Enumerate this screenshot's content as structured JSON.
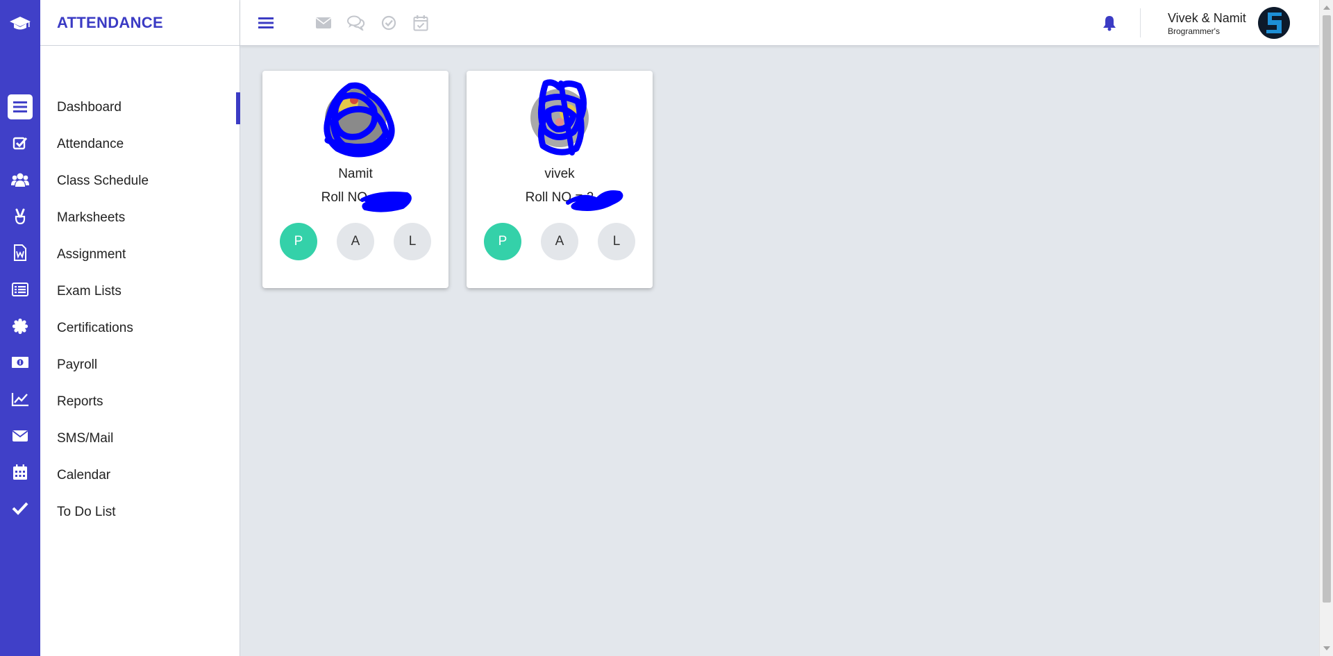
{
  "app": {
    "brand_title": "ATTENDANCE",
    "accent_color": "#3b3bc4",
    "present_color": "#34d1a9"
  },
  "rail": {
    "logo_icon": "graduation-cap-icon",
    "icons": [
      "list-icon",
      "check-square-icon",
      "users-icon",
      "victory-hand-icon",
      "word-document-icon",
      "list-alt-icon",
      "certificate-icon",
      "money-bill-icon",
      "line-chart-icon",
      "envelope-icon",
      "calendar-icon",
      "checkmark-icon"
    ]
  },
  "sidebar": {
    "active_index": 0,
    "items": [
      {
        "label": "Dashboard"
      },
      {
        "label": "Attendance"
      },
      {
        "label": "Class Schedule"
      },
      {
        "label": "Marksheets"
      },
      {
        "label": "Assignment"
      },
      {
        "label": "Exam Lists"
      },
      {
        "label": "Certifications"
      },
      {
        "label": "Payroll"
      },
      {
        "label": "Reports"
      },
      {
        "label": "SMS/Mail"
      },
      {
        "label": "Calendar"
      },
      {
        "label": "To Do List"
      }
    ]
  },
  "header": {
    "icons": [
      "menu-icon",
      "envelope-icon",
      "comments-icon",
      "check-circle-icon",
      "calendar-check-icon",
      "bell-icon"
    ],
    "user_name": "Vivek & Namit",
    "user_org": "Brogrammer's"
  },
  "students": [
    {
      "name": "Namit",
      "roll_label": "Roll NO = 2",
      "status": "P",
      "buttons": [
        "P",
        "A",
        "L"
      ]
    },
    {
      "name": "vivek",
      "roll_label": "Roll NO = 2",
      "status": "P",
      "buttons": [
        "P",
        "A",
        "L"
      ]
    }
  ]
}
